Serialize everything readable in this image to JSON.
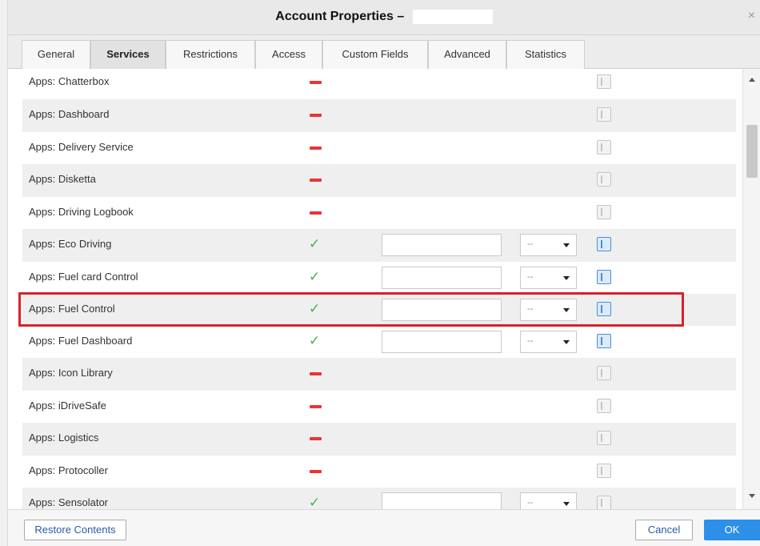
{
  "window": {
    "title": "Account Properties –",
    "close_symbol": "×"
  },
  "tabs": [
    {
      "label": "General",
      "active": false
    },
    {
      "label": "Services",
      "active": true
    },
    {
      "label": "Restrictions",
      "active": false
    },
    {
      "label": "Access",
      "active": false
    },
    {
      "label": "Custom Fields",
      "active": false
    },
    {
      "label": "Advanced",
      "active": false
    },
    {
      "label": "Statistics",
      "active": false
    }
  ],
  "services": [
    {
      "name": "Apps: Chatterbox",
      "enabled": false
    },
    {
      "name": "Apps: Dashboard",
      "enabled": false
    },
    {
      "name": "Apps: Delivery Service",
      "enabled": false
    },
    {
      "name": "Apps: Disketta",
      "enabled": false
    },
    {
      "name": "Apps: Driving Logbook",
      "enabled": false
    },
    {
      "name": "Apps: Eco Driving",
      "enabled": true,
      "select_value": "--"
    },
    {
      "name": "Apps: Fuel card Control",
      "enabled": true,
      "select_value": "--"
    },
    {
      "name": "Apps: Fuel Control",
      "enabled": true,
      "select_value": "--",
      "highlighted": true
    },
    {
      "name": "Apps: Fuel Dashboard",
      "enabled": true,
      "select_value": "--"
    },
    {
      "name": "Apps: Icon Library",
      "enabled": false
    },
    {
      "name": "Apps: iDriveSafe",
      "enabled": false
    },
    {
      "name": "Apps: Logistics",
      "enabled": false
    },
    {
      "name": "Apps: Protocoller",
      "enabled": false
    },
    {
      "name": "Apps: Sensolator",
      "enabled": true,
      "select_value": "--"
    }
  ],
  "icons": {
    "enabled": "check-icon",
    "disabled": "minus-icon",
    "info": "info-icon",
    "select": "chevron-down-icon"
  },
  "colors": {
    "enabled": "#3cb54a",
    "disabled": "#e8353a",
    "highlight": "#d6222b",
    "primary_button": "#2c8fe8"
  },
  "footer": {
    "restore_label": "Restore Contents",
    "cancel_label": "Cancel",
    "ok_label": "OK"
  }
}
